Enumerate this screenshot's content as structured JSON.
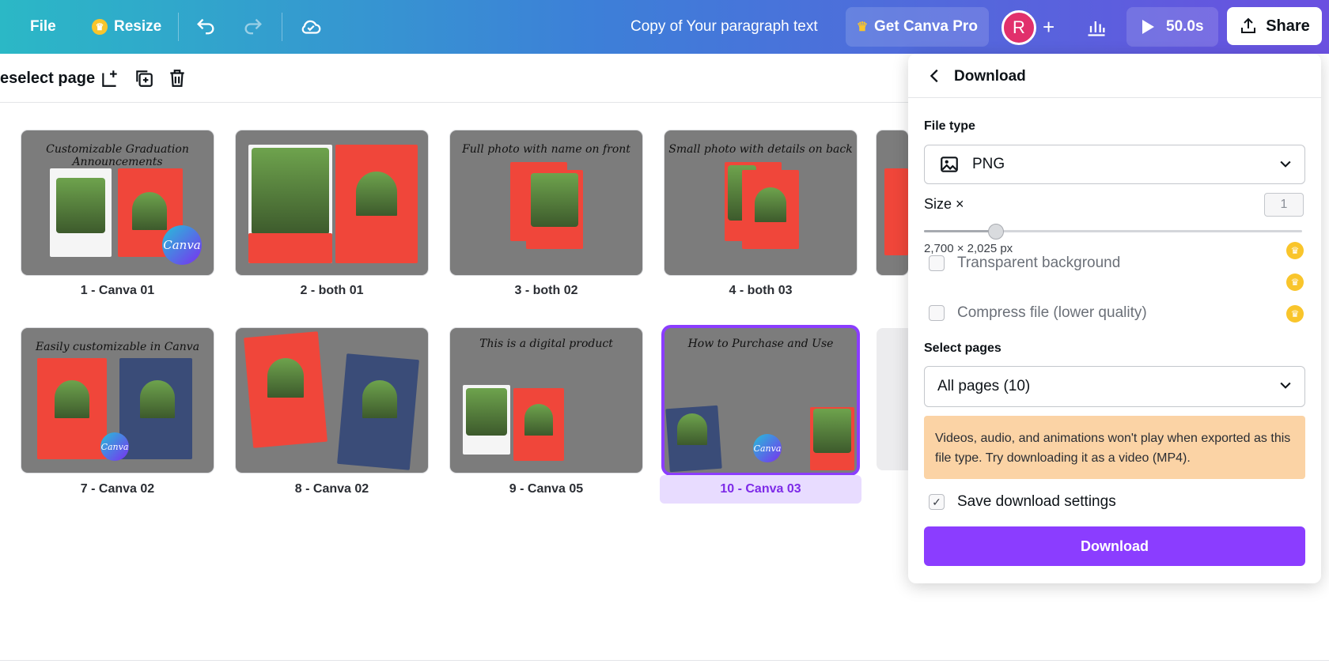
{
  "topbar": {
    "file_label": "File",
    "resize_label": "Resize",
    "doc_title": "Copy of Your paragraph text",
    "get_pro_label": "Get Canva Pro",
    "avatar_initial": "R",
    "add_label": "+",
    "timer_label": "50.0s",
    "share_label": "Share"
  },
  "subbar": {
    "deselect_label": "eselect page"
  },
  "pages": [
    {
      "label": "1 - Canva 01",
      "headline": "Customizable Graduation Announcements"
    },
    {
      "label": "2 - both 01",
      "headline": ""
    },
    {
      "label": "3 - both 02",
      "headline": "Full photo with name on front"
    },
    {
      "label": "4 - both 03",
      "headline": "Small photo with details on back"
    },
    {
      "label": "7 - Canva 02",
      "headline": "Easily customizable in Canva"
    },
    {
      "label": "8 - Canva 02",
      "headline": ""
    },
    {
      "label": "9 - Canva 05",
      "headline": "This is a digital product"
    },
    {
      "label": "10 - Canva 03",
      "headline": "How to Purchase and Use"
    }
  ],
  "canva_badge": "Canva",
  "download_panel": {
    "title": "Download",
    "file_type_label": "File type",
    "file_type_value": "PNG",
    "size_label": "Size ×",
    "size_value": "1",
    "size_fraction": 0.19,
    "dimensions": "2,700 × 2,025 px",
    "transparent_label": "Transparent background",
    "compress_label": "Compress file (lower quality)",
    "select_pages_label": "Select pages",
    "select_pages_value": "All pages (10)",
    "warning_text": "Videos, audio, and animations won't play when exported as this file type. Try downloading it as a video (MP4).",
    "save_settings_label": "Save download settings",
    "save_settings_checked": true,
    "download_button": "Download"
  },
  "colors": {
    "accent": "#8b3dff",
    "warning_bg": "#fbd3a5",
    "crown": "#f9c52b"
  }
}
